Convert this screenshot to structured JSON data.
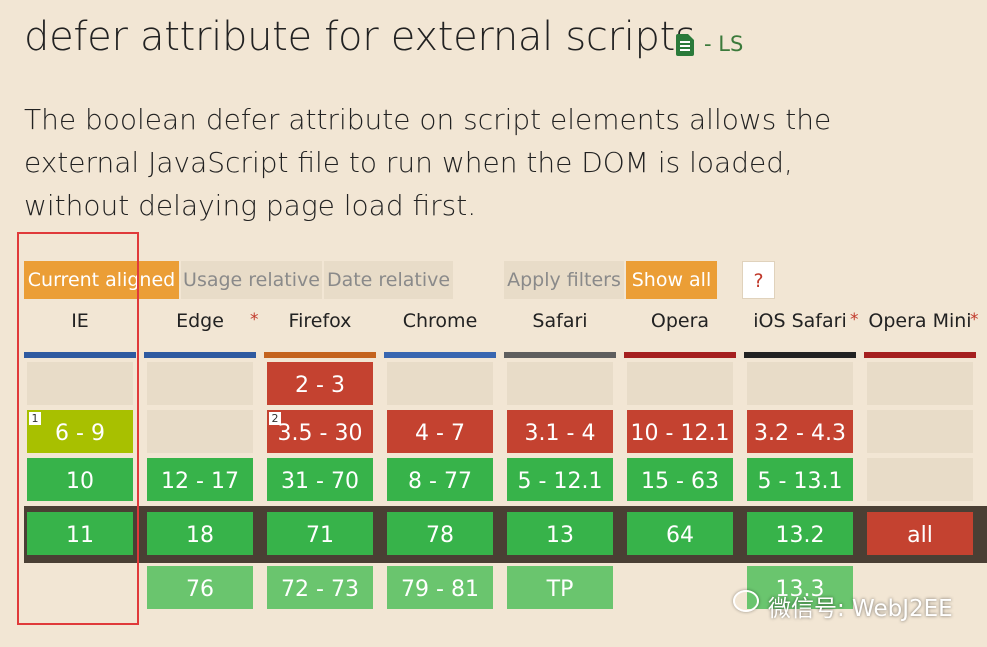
{
  "header": {
    "title": "defer attribute for external scripts",
    "status": "- LS",
    "description": "The boolean defer attribute on script elements allows the external JavaScript file to run when the DOM is loaded, without delaying page load first."
  },
  "toolbar": {
    "current_aligned": "Current aligned",
    "usage_relative": "Usage relative",
    "date_relative": "Date relative",
    "apply_filters": "Apply filters",
    "show_all": "Show all",
    "help": "?"
  },
  "browsers": [
    {
      "name": "IE",
      "star": "",
      "underline": "#2f5aa0",
      "pre3": "",
      "pre2": "6 - 9",
      "pre1": "10",
      "current": "11",
      "next": "",
      "pre2_note": "1"
    },
    {
      "name": "Edge",
      "star": "*",
      "underline": "#2f5aa0",
      "pre3": "",
      "pre2": "",
      "pre1": "12 - 17",
      "current": "18",
      "next": "76",
      "pre2_note": ""
    },
    {
      "name": "Firefox",
      "star": "",
      "underline": "#c4631e",
      "pre3": "2 - 3",
      "pre2": "3.5 - 30",
      "pre1": "31 - 70",
      "current": "71",
      "next": "72 - 73",
      "pre2_note": "2"
    },
    {
      "name": "Chrome",
      "star": "",
      "underline": "#3866b0",
      "pre3": "",
      "pre2": "4 - 7",
      "pre1": "8 - 77",
      "current": "78",
      "next": "79 - 81",
      "pre2_note": ""
    },
    {
      "name": "Safari",
      "star": "",
      "underline": "#5e5e5e",
      "pre3": "",
      "pre2": "3.1 - 4",
      "pre1": "5 - 12.1",
      "current": "13",
      "next": "TP",
      "pre2_note": ""
    },
    {
      "name": "Opera",
      "star": "",
      "underline": "#a51f1f",
      "pre3": "",
      "pre2": "10 - 12.1",
      "pre1": "15 - 63",
      "current": "64",
      "next": "",
      "pre2_note": ""
    },
    {
      "name": "iOS Safari",
      "star": "*",
      "underline": "#222222",
      "pre3": "",
      "pre2": "3.2 - 4.3",
      "pre1": "5 - 13.1",
      "current": "13.2",
      "next": "13.3",
      "pre2_note": ""
    },
    {
      "name": "Opera Mini",
      "star": "*",
      "underline": "#a51f1f",
      "pre3": "",
      "pre2": "",
      "pre1": "",
      "current": "all",
      "next": "",
      "pre2_note": ""
    }
  ],
  "watermark": "微信号: WebJ2EE",
  "colors": {
    "supported": "#37b34a",
    "unsupported": "#c44230",
    "partial": "#a8c000",
    "accent": "#eb9e36",
    "highlight_box": "#e03a3a"
  }
}
